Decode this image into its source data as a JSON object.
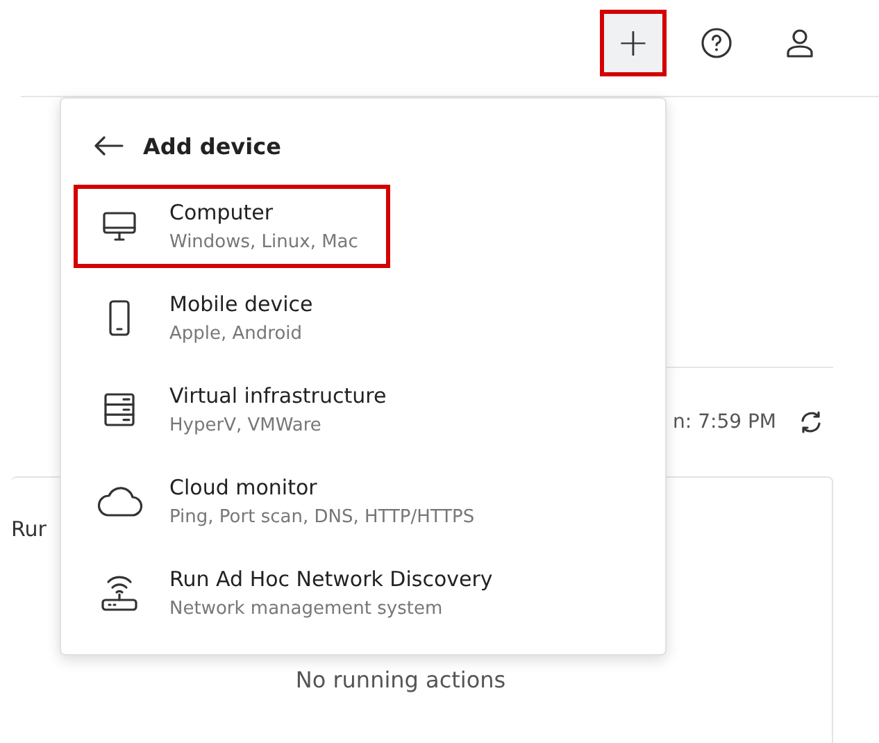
{
  "toolbar": {
    "buttons": [
      {
        "kind": "add",
        "label": "+",
        "highlighted": true
      },
      {
        "kind": "help",
        "highlighted": false
      },
      {
        "kind": "account",
        "highlighted": false
      }
    ]
  },
  "status": {
    "updated": "n: 7:59 PM"
  },
  "actions_card": {
    "title": "Rur",
    "empty_text": "No running actions"
  },
  "add_device_menu": {
    "title": "Add device",
    "items": [
      {
        "kind": "computer",
        "title": "Computer",
        "subtitle": "Windows, Linux, Mac",
        "highlighted": true
      },
      {
        "kind": "mobile",
        "title": "Mobile device",
        "subtitle": "Apple, Android",
        "highlighted": false
      },
      {
        "kind": "server",
        "title": "Virtual infrastructure",
        "subtitle": "HyperV, VMWare",
        "highlighted": false
      },
      {
        "kind": "cloud",
        "title": "Cloud monitor",
        "subtitle": "Ping, Port scan, DNS, HTTP/HTTPS",
        "highlighted": false
      },
      {
        "kind": "router",
        "title": "Run Ad Hoc Network Discovery",
        "subtitle": "Network management system",
        "highlighted": false
      }
    ]
  }
}
